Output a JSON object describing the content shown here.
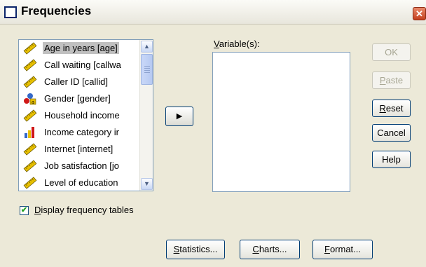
{
  "window": {
    "title": "Frequencies",
    "close_glyph": "✕"
  },
  "source_list": {
    "items": [
      {
        "label": "Age in years [age]",
        "icon": "scale-ruler-icon",
        "selected": true
      },
      {
        "label": "Call waiting [callwa",
        "icon": "scale-ruler-icon"
      },
      {
        "label": "Caller ID [callid]",
        "icon": "scale-ruler-icon"
      },
      {
        "label": "Gender [gender]",
        "icon": "nominal-icon"
      },
      {
        "label": "Household income",
        "icon": "scale-ruler-icon"
      },
      {
        "label": "Income category ir",
        "icon": "ordinal-bars-icon"
      },
      {
        "label": "Internet [internet]",
        "icon": "scale-ruler-icon"
      },
      {
        "label": "Job satisfaction [jo",
        "icon": "scale-ruler-icon"
      },
      {
        "label": "Level of education",
        "icon": "scale-ruler-icon"
      }
    ]
  },
  "move_button": {
    "glyph": "▶"
  },
  "target": {
    "label_prefix": "",
    "label_mnemonic": "V",
    "label_rest": "ariable(s):"
  },
  "buttons": {
    "ok": "OK",
    "paste_m": "P",
    "paste_r": "aste",
    "reset_m": "R",
    "reset_r": "eset",
    "cancel": "Cancel",
    "help": "Help"
  },
  "display_tables": {
    "mnemonic": "D",
    "rest": "isplay frequency tables",
    "checked": true
  },
  "bottom_buttons": {
    "statistics_m": "S",
    "statistics_r": "tatistics...",
    "charts_m": "C",
    "charts_r": "harts...",
    "format_m": "F",
    "format_r": "ormat..."
  },
  "colors": {
    "dialog_bg": "#ece9d8",
    "selection": "#c0c0c0",
    "scale_icon": "#e8c000"
  }
}
